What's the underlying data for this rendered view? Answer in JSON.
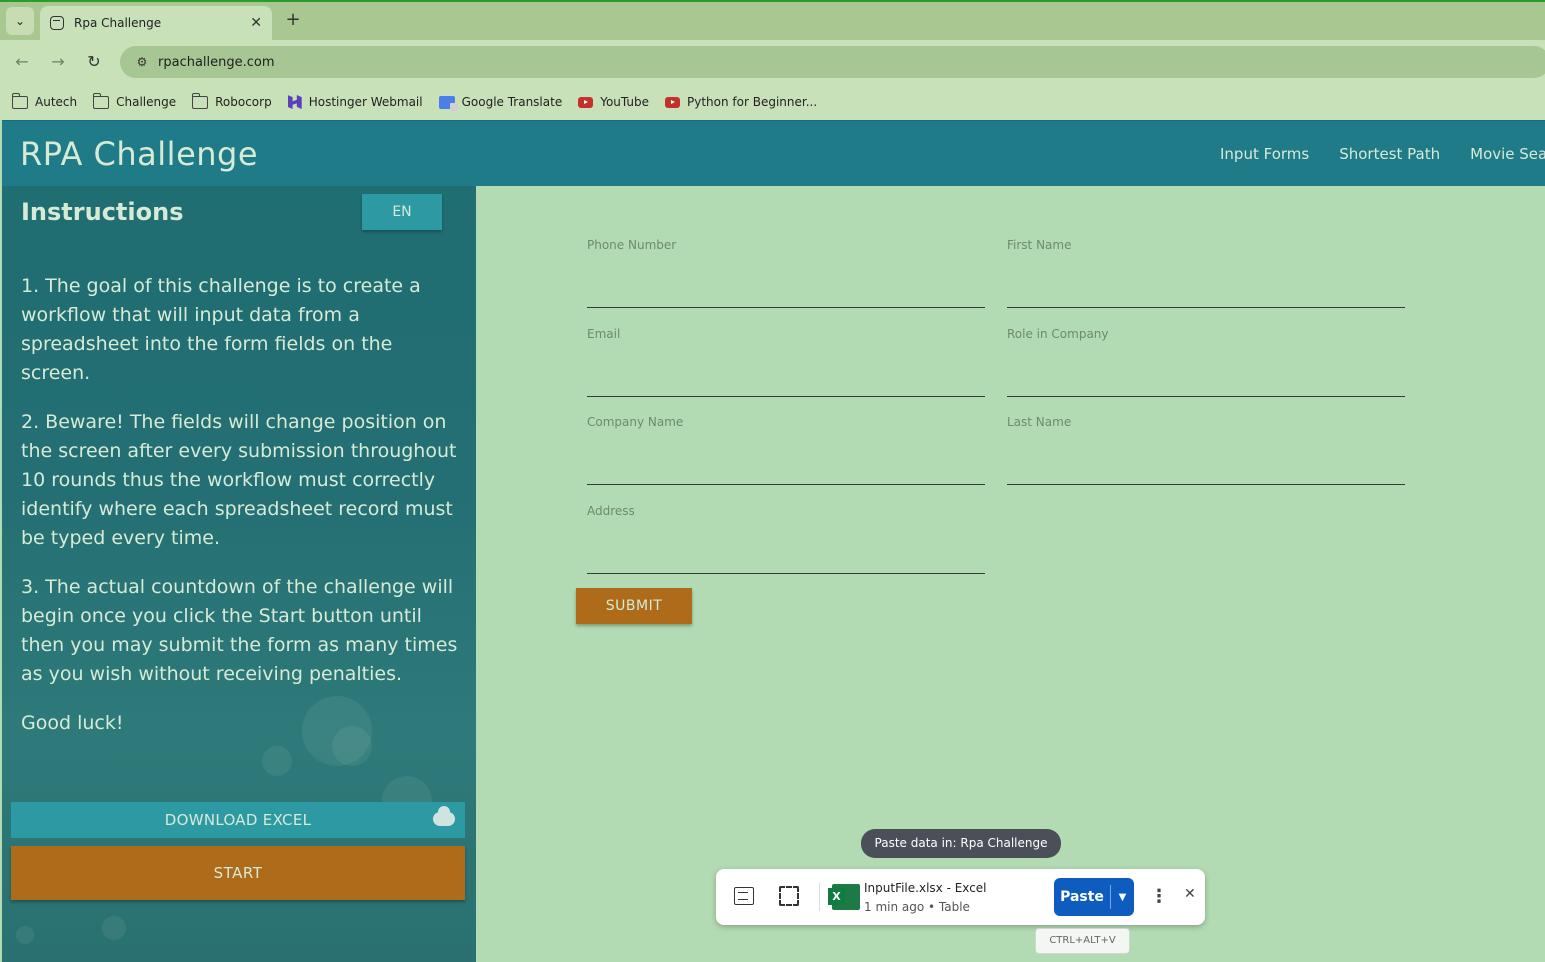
{
  "browser": {
    "tab_title": "Rpa Challenge",
    "url": "rpachallenge.com",
    "bookmarks": [
      {
        "label": "Autech",
        "icon": "folder-icon"
      },
      {
        "label": "Challenge",
        "icon": "folder-icon"
      },
      {
        "label": "Robocorp",
        "icon": "folder-icon"
      },
      {
        "label": "Hostinger Webmail",
        "icon": "hostinger-icon"
      },
      {
        "label": "Google Translate",
        "icon": "google-translate-icon"
      },
      {
        "label": "YouTube",
        "icon": "youtube-icon"
      },
      {
        "label": "Python for Beginner...",
        "icon": "youtube-icon"
      }
    ]
  },
  "header": {
    "brand": "RPA Challenge",
    "nav": [
      "Input Forms",
      "Shortest Path",
      "Movie Sea"
    ]
  },
  "sidebar": {
    "title": "Instructions",
    "lang": "EN",
    "paragraphs": [
      "1. The goal of this challenge is to create a workflow that will input data from a spreadsheet into the form fields on the screen.",
      "2. Beware! The fields will change position on the screen after every submission throughout 10 rounds thus the workflow must correctly identify where each spreadsheet record must be typed every time.",
      "3. The actual countdown of the challenge will begin once you click the Start button until then you may submit the form as many times as you wish without receiving penalties.",
      "Good luck!"
    ],
    "download_label": "DOWNLOAD EXCEL",
    "start_label": "START"
  },
  "form": {
    "fields": [
      {
        "label": "Phone Number",
        "value": ""
      },
      {
        "label": "First Name",
        "value": ""
      },
      {
        "label": "Email",
        "value": ""
      },
      {
        "label": "Role in Company",
        "value": ""
      },
      {
        "label": "Company Name",
        "value": ""
      },
      {
        "label": "Last Name",
        "value": ""
      },
      {
        "label": "Address",
        "value": ""
      }
    ],
    "submit_label": "SUBMIT"
  },
  "paste_popup": {
    "tip": "Paste data in: Rpa Challenge",
    "file_name": "InputFile.xlsx - Excel",
    "meta": "1 min ago • Table",
    "paste_label": "Paste",
    "shortcut": "CTRL+ALT+V"
  },
  "colors": {
    "header": "#1f7b88",
    "sidebar": "#246f73",
    "page_bg": "#b3dbb3",
    "accent_orange": "#ae6b19",
    "teal_button": "#2d9aa3"
  }
}
